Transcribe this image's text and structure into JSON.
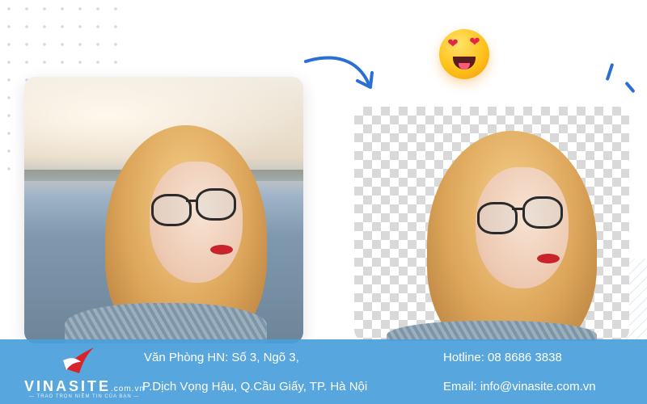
{
  "images": {
    "original_photo": "woman-with-glasses-original",
    "cutout_photo": "woman-with-glasses-background-removed"
  },
  "icons": {
    "arrow": "curved-arrow-icon",
    "emoji": "heart-eyes-emoji-icon"
  },
  "colors": {
    "accent": "#2b6fd6",
    "footer_bg": "#4a9edb",
    "checker": "#d9d9d9"
  },
  "footer": {
    "logo": {
      "name": "VINASITE",
      "domain": ".com.vn",
      "slogan": "— TRAO TRỌN NIỀM TIN CỦA BẠN —"
    },
    "address_line1": "Văn Phòng HN: Số 3, Ngõ 3,",
    "address_line2": "P.Dịch Vọng Hậu, Q.Cầu Giấy, TP. Hà Nội",
    "hotline": "Hotline: 08 8686 3838",
    "email": "Email: info@vinasite.com.vn"
  }
}
